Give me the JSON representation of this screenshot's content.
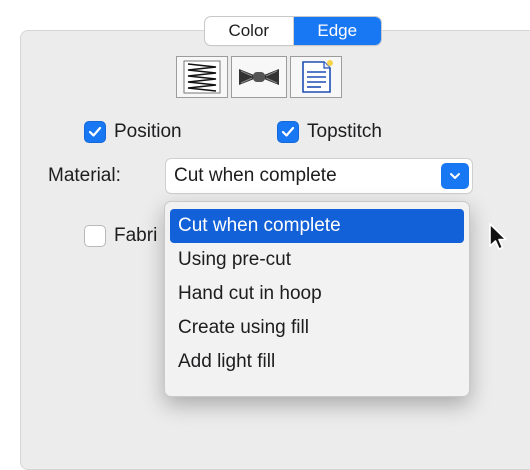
{
  "tabs": [
    {
      "label": "Color",
      "active": false
    },
    {
      "label": "Edge",
      "active": true
    }
  ],
  "stitch_icons": [
    "zigzag-stitch-icon",
    "bowtie-stitch-icon",
    "document-stitch-icon"
  ],
  "checkboxes": {
    "position": {
      "label": "Position",
      "checked": true
    },
    "topstitch": {
      "label": "Topstitch",
      "checked": true
    },
    "fabric": {
      "label": "Fabri",
      "checked": false
    }
  },
  "material": {
    "label": "Material:",
    "selected": "Cut when complete",
    "options": [
      "Cut when complete",
      "Using pre-cut",
      "Hand cut in hoop",
      "Create using fill",
      "Add light fill"
    ]
  },
  "colors": {
    "accent": "#1877f2",
    "panel": "#ececec",
    "highlight": "#1361d8"
  }
}
